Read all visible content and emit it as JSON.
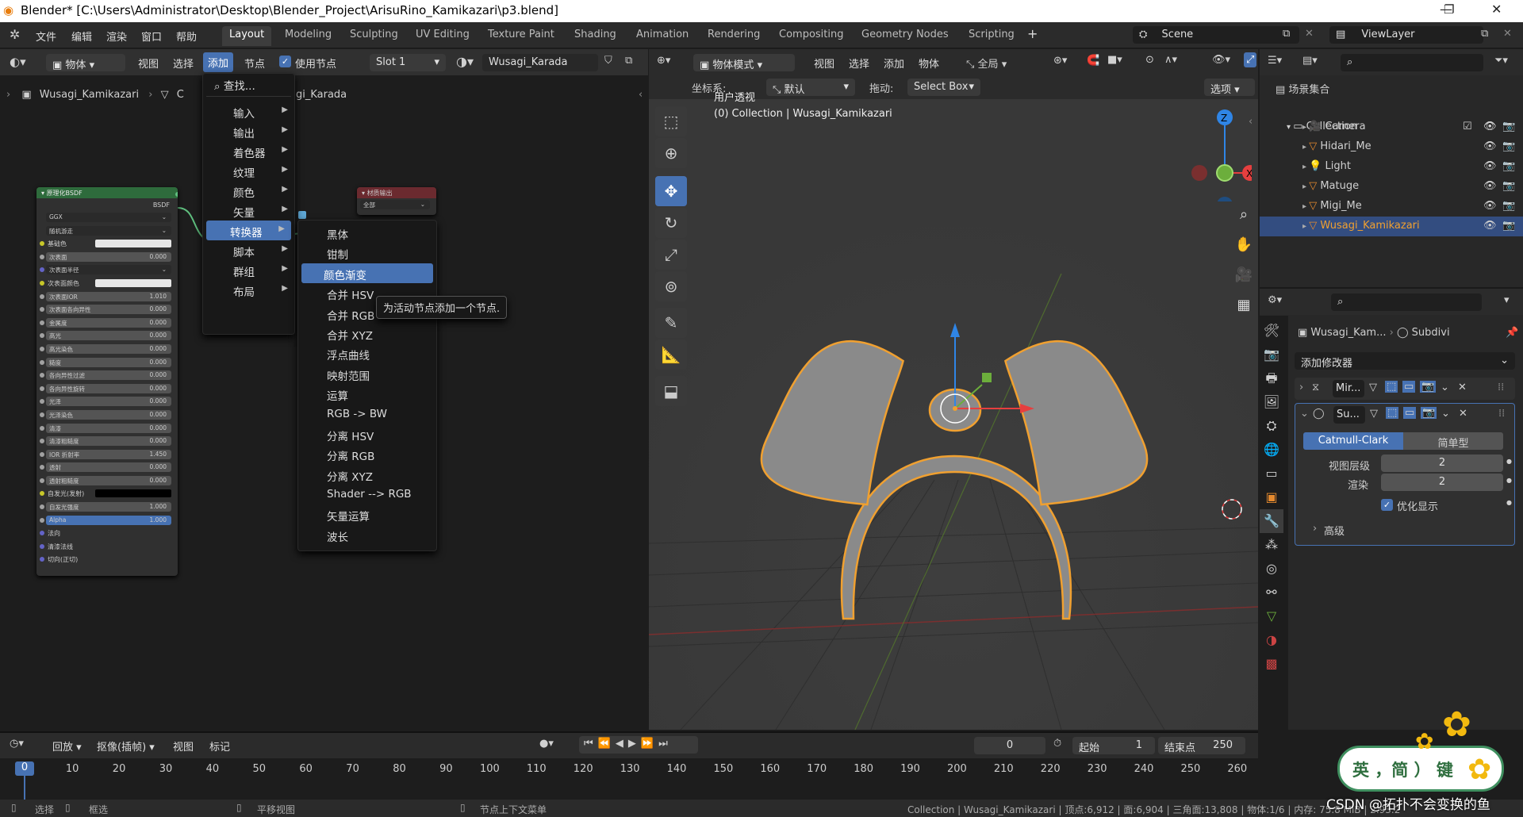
{
  "window": {
    "title": "Blender* [C:\\Users\\Administrator\\Desktop\\Blender_Project\\ArisuRino_Kamikazari\\p3.blend]"
  },
  "top_menu": [
    "文件",
    "编辑",
    "渲染",
    "窗口",
    "帮助"
  ],
  "workspaces": [
    "Layout",
    "Modeling",
    "Sculpting",
    "UV Editing",
    "Texture Paint",
    "Shading",
    "Animation",
    "Rendering",
    "Compositing",
    "Geometry Nodes",
    "Scripting"
  ],
  "scene": {
    "name": "Scene",
    "view_layer": "ViewLayer"
  },
  "node_editor": {
    "header": {
      "mode": "物体",
      "menus": [
        "视图",
        "选择",
        "添加",
        "节点"
      ],
      "use_nodes_label": "使用节点",
      "slot": "Slot 1",
      "material": "Wusagi_Karada"
    },
    "breadcrumb": {
      "object": "Wusagi_Kamikazari",
      "c": "C",
      "material": "agi_Karada"
    },
    "bsdf_node": {
      "title": "原理化BSDF",
      "output": "BSDF",
      "dist": "GGX",
      "subsurface_method": "随机游走",
      "rows": [
        {
          "label": "基础色",
          "type": "color",
          "color": "#e6e6e6"
        },
        {
          "label": "次表面",
          "value": "0.000"
        },
        {
          "label": "次表面半径",
          "type": "dropdown"
        },
        {
          "label": "次表面颜色",
          "type": "color",
          "color": "#e6e6e6"
        },
        {
          "label": "次表面IOR",
          "value": "1.010"
        },
        {
          "label": "次表面各向异性",
          "value": "0.000"
        },
        {
          "label": "金属度",
          "value": "0.000"
        },
        {
          "label": "高光",
          "value": "0.000"
        },
        {
          "label": "高光染色",
          "value": "0.000"
        },
        {
          "label": "糙度",
          "value": "0.000"
        },
        {
          "label": "各向异性过滤",
          "value": "0.000"
        },
        {
          "label": "各向异性旋转",
          "value": "0.000"
        },
        {
          "label": "光泽",
          "value": "0.000"
        },
        {
          "label": "光泽染色",
          "value": "0.000"
        },
        {
          "label": "清漆",
          "value": "0.000"
        },
        {
          "label": "清漆粗糙度",
          "value": "0.000"
        },
        {
          "label": "IOR 折射率",
          "value": "1.450"
        },
        {
          "label": "透射",
          "value": "0.000"
        },
        {
          "label": "透射粗糙度",
          "value": "0.000"
        },
        {
          "label": "自发光(发射)",
          "type": "color",
          "color": "#000000"
        },
        {
          "label": "自发光强度",
          "value": "1.000"
        },
        {
          "label": "Alpha",
          "value": "1.000",
          "type": "hl"
        },
        {
          "label": "法向",
          "type": "socket"
        },
        {
          "label": "清漆法线",
          "type": "socket"
        },
        {
          "label": "切向(正切)",
          "type": "socket"
        }
      ]
    },
    "output_node": {
      "title": "材质输出",
      "target": "全部"
    }
  },
  "add_menu": {
    "search": "查找...",
    "items": [
      "输入",
      "输出",
      "着色器",
      "纹理",
      "颜色",
      "矢量",
      "转换器",
      "脚本",
      "群组",
      "布局"
    ],
    "active": "转换器"
  },
  "converter_menu": {
    "items": [
      "黑体",
      "钳制",
      "颜色渐变",
      "合并 HSV",
      "合并 RGB",
      "合并 XYZ",
      "浮点曲线",
      "映射范围",
      "运算",
      "RGB -> BW",
      "分离 HSV",
      "分离 RGB",
      "分离 XYZ",
      "Shader --> RGB",
      "矢量运算",
      "波长"
    ],
    "highlight": "颜色渐变",
    "tooltip": "为活动节点添加一个节点."
  },
  "viewport": {
    "mode": "物体模式",
    "menus": [
      "视图",
      "选择",
      "添加",
      "物体"
    ],
    "transform_space": "全局",
    "coord_label": "坐标系:",
    "coord_value": "默认",
    "drag_label": "拖动:",
    "drag_value": "Select Box",
    "options": "选项",
    "overlay_title": "用户透视",
    "overlay_sub": "(0) Collection | Wusagi_Kamikazari"
  },
  "outliner": {
    "scene_collection": "场景集合",
    "collection": "Collection",
    "objects": [
      "Camera",
      "Hidari_Me",
      "Light",
      "Matuge",
      "Migi_Me",
      "Wusagi_Kamikazari"
    ],
    "selected": "Wusagi_Kamikazari"
  },
  "properties": {
    "object": "Wusagi_Kam...",
    "modifier_name": "Subdivi",
    "add_modifier": "添加修改器",
    "mod1": "Mir...",
    "mod2": "Su...",
    "tab_catmull": "Catmull-Clark",
    "tab_simple": "简单型",
    "viewport_levels_label": "视图层级",
    "viewport_levels": "2",
    "render_label": "渲染",
    "render_levels": "2",
    "optimal_label": "优化显示",
    "advanced": "高级"
  },
  "timeline": {
    "menus": [
      "回放",
      "抠像(插帧)",
      "视图",
      "标记"
    ],
    "current": "0",
    "start_label": "起始",
    "start": "1",
    "end_label": "结束点",
    "end": "250",
    "ticks": [
      "0",
      "10",
      "20",
      "30",
      "40",
      "50",
      "60",
      "70",
      "80",
      "90",
      "100",
      "110",
      "120",
      "130",
      "140",
      "150",
      "160",
      "170",
      "180",
      "190",
      "200",
      "210",
      "220",
      "230",
      "240",
      "250",
      "260"
    ]
  },
  "statusbar": {
    "select": "选择",
    "box": "框选",
    "pan": "平移视图",
    "context": "节点上下文菜单",
    "info": "Collection | Wusagi_Kamikazari | 顶点:6,912 | 面:6,904 | 三角面:13,808 | 物体:1/6 | 内存: 75.8 MiB | 2.93.2"
  },
  "watermark": "CSDN @拓扑不会变换的鱼",
  "ime": {
    "label": "英 ，简 ） 键"
  }
}
